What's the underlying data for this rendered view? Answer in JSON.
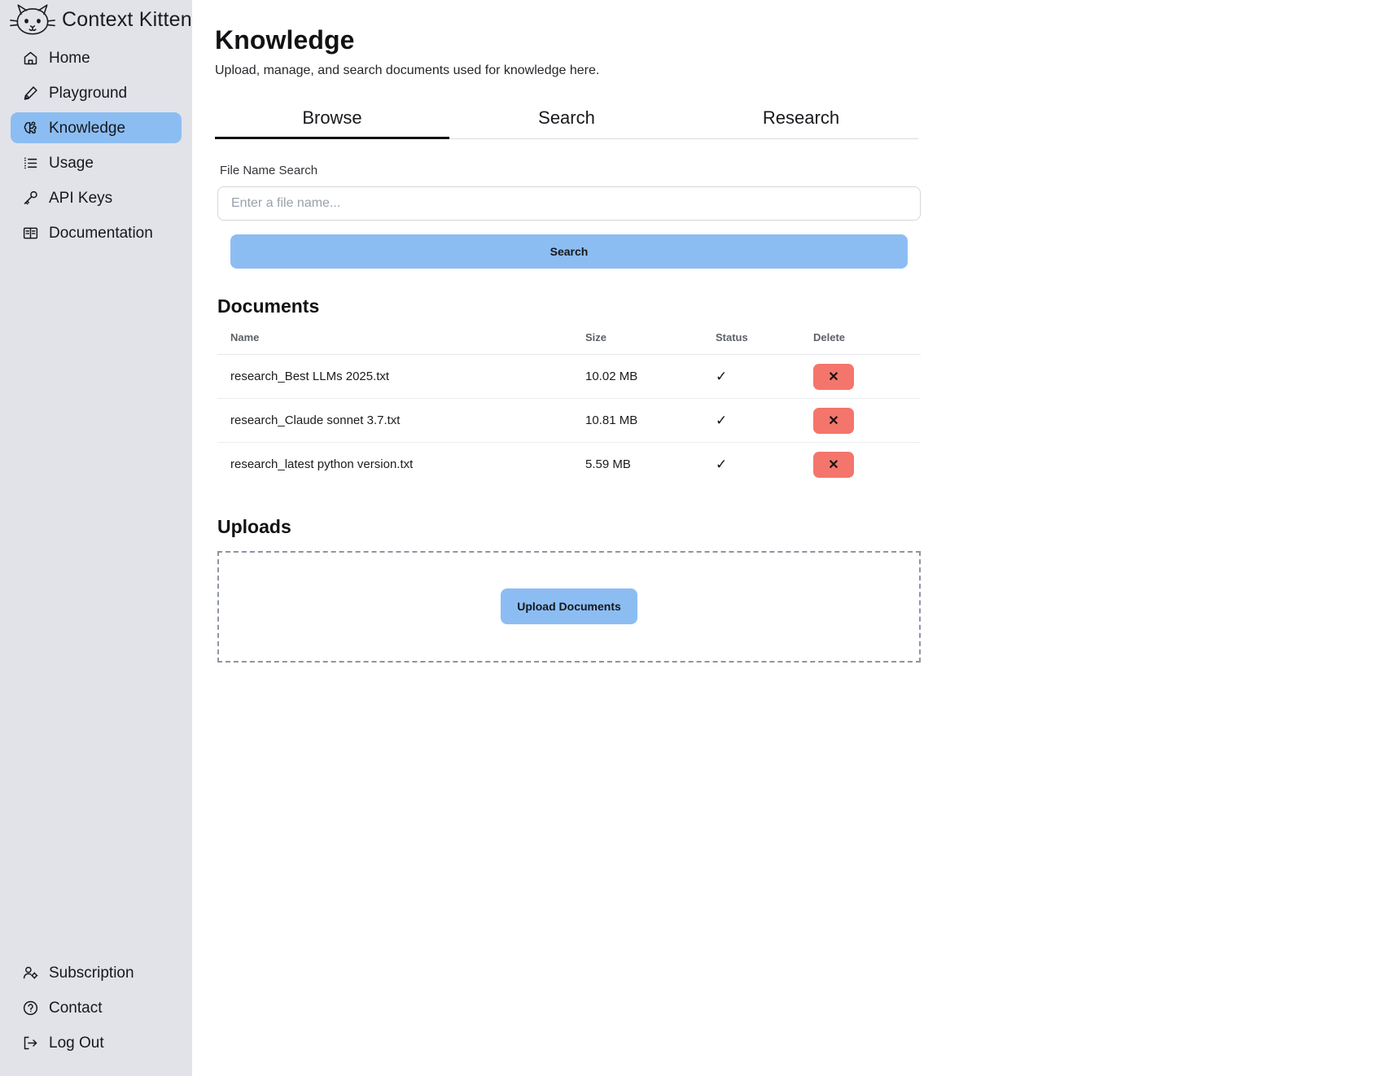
{
  "brand": {
    "name": "Context Kitten",
    "logo_icon": "cat-face-icon"
  },
  "sidebar": {
    "top_items": [
      {
        "label": "Home",
        "icon": "home-icon",
        "active": false
      },
      {
        "label": "Playground",
        "icon": "pen-icon",
        "active": false
      },
      {
        "label": "Knowledge",
        "icon": "brain-icon",
        "active": true
      },
      {
        "label": "Usage",
        "icon": "list-icon",
        "active": false
      },
      {
        "label": "API Keys",
        "icon": "key-icon",
        "active": false
      },
      {
        "label": "Documentation",
        "icon": "book-icon",
        "active": false
      }
    ],
    "bottom_items": [
      {
        "label": "Subscription",
        "icon": "user-gear-icon"
      },
      {
        "label": "Contact",
        "icon": "question-circle-icon"
      },
      {
        "label": "Log Out",
        "icon": "logout-icon"
      }
    ]
  },
  "header": {
    "title": "Knowledge",
    "subtitle": "Upload, manage, and search documents used for knowledge here."
  },
  "tabs": [
    {
      "label": "Browse",
      "active": true
    },
    {
      "label": "Search",
      "active": false
    },
    {
      "label": "Research",
      "active": false
    }
  ],
  "search": {
    "label": "File Name Search",
    "placeholder": "Enter a file name...",
    "value": "",
    "button_label": "Search"
  },
  "documents": {
    "title": "Documents",
    "columns": [
      "Name",
      "Size",
      "Status",
      "Delete"
    ],
    "rows": [
      {
        "name": "research_Best LLMs 2025.txt",
        "size": "10.02 MB",
        "status": "✓",
        "delete_label": "✕"
      },
      {
        "name": "research_Claude sonnet 3.7.txt",
        "size": "10.81 MB",
        "status": "✓",
        "delete_label": "✕"
      },
      {
        "name": "research_latest python version.txt",
        "size": "5.59 MB",
        "status": "✓",
        "delete_label": "✕"
      }
    ]
  },
  "uploads": {
    "title": "Uploads",
    "button_label": "Upload Documents"
  },
  "colors": {
    "sidebar_bg": "#e1e3e8",
    "accent_blue": "#8cbdf2",
    "delete_red": "#f4756b",
    "text_dark": "#111214"
  }
}
